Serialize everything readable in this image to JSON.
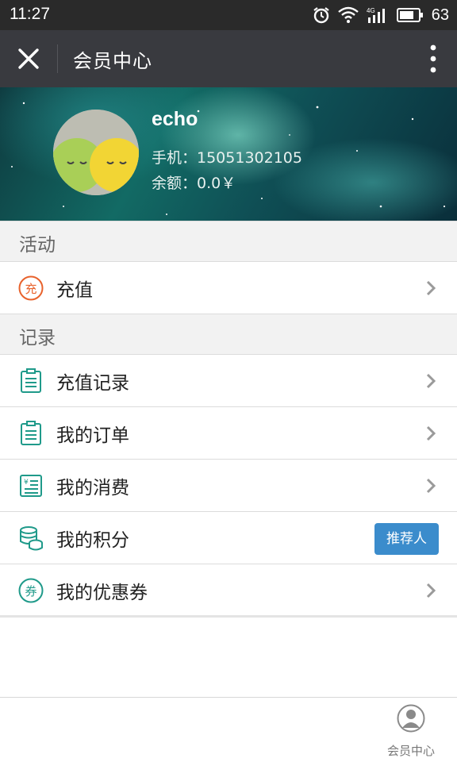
{
  "status_bar": {
    "time": "11:27",
    "battery": "63"
  },
  "title_bar": {
    "title": "会员中心"
  },
  "profile": {
    "name": "echo",
    "phone": "手机：15051302105",
    "balance": "余额：0.0￥"
  },
  "sections": {
    "activity": {
      "header": "活动",
      "items": [
        {
          "label": "充值",
          "icon": "recharge-circle-icon",
          "icon_text": "充",
          "icon_color": "#e8622c"
        }
      ]
    },
    "records": {
      "header": "记录",
      "items": [
        {
          "label": "充值记录",
          "icon": "clipboard-icon",
          "icon_color": "#1f9a8a"
        },
        {
          "label": "我的订单",
          "icon": "clipboard-icon",
          "icon_color": "#1f9a8a"
        },
        {
          "label": "我的消费",
          "icon": "receipt-yen-icon",
          "icon_color": "#1f9a8a"
        },
        {
          "label": "我的积分",
          "icon": "coins-stack-icon",
          "icon_color": "#1f9a8a",
          "tag": "推荐人"
        },
        {
          "label": "我的优惠券",
          "icon": "coupon-circle-icon",
          "icon_text": "券",
          "icon_color": "#1f9a8a"
        }
      ]
    }
  },
  "colors": {
    "accent_button": "#3b8ccc",
    "titlebar": "#393a3f",
    "statusbar": "#2a2a2a"
  },
  "tab_bar": {
    "items": [
      {
        "label": "会员中心",
        "icon": "user-avatar-icon"
      }
    ]
  }
}
